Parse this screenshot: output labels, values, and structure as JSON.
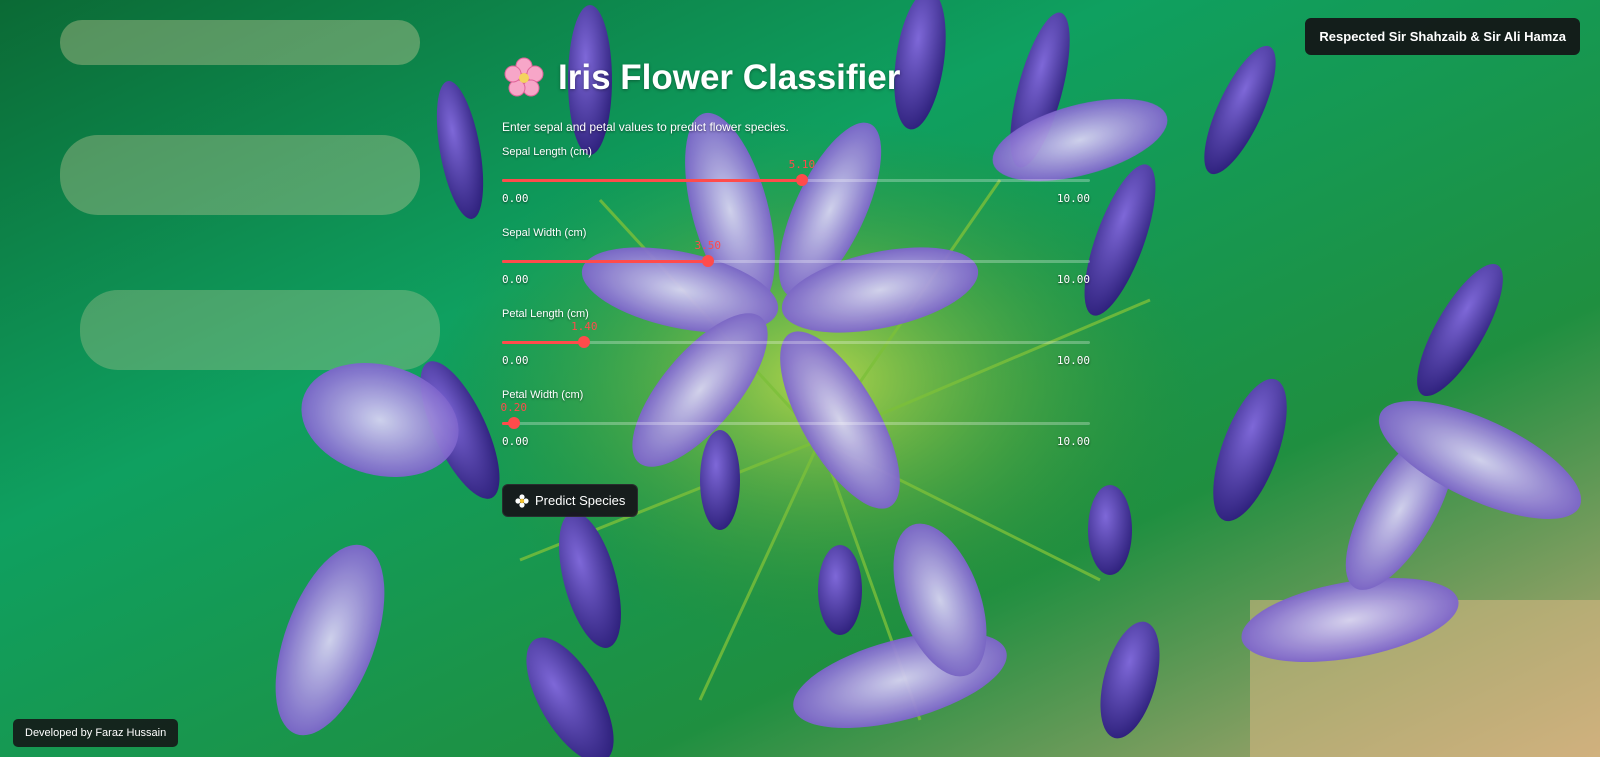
{
  "header": {
    "title": "Iris Flower Classifier",
    "subtitle": "Enter sepal and petal values to predict flower species.",
    "title_icon": "cherry-blossom-icon"
  },
  "top_badge": "Respected Sir Shahzaib & Sir Ali Hamza",
  "footer_badge": "Developed by Faraz Hussain",
  "sliders": [
    {
      "label": "Sepal Length (cm)",
      "value": "5.10",
      "num": 5.1,
      "min": "0.00",
      "max": "10.00"
    },
    {
      "label": "Sepal Width (cm)",
      "value": "3.50",
      "num": 3.5,
      "min": "0.00",
      "max": "10.00"
    },
    {
      "label": "Petal Length (cm)",
      "value": "1.40",
      "num": 1.4,
      "min": "0.00",
      "max": "10.00"
    },
    {
      "label": "Petal Width (cm)",
      "value": "0.20",
      "num": 0.2,
      "min": "0.00",
      "max": "10.00"
    }
  ],
  "predict_button": {
    "label": "Predict Species",
    "icon": "flower-icon"
  },
  "colors": {
    "accent": "#ff4b4b",
    "badge_bg": "#141416"
  }
}
